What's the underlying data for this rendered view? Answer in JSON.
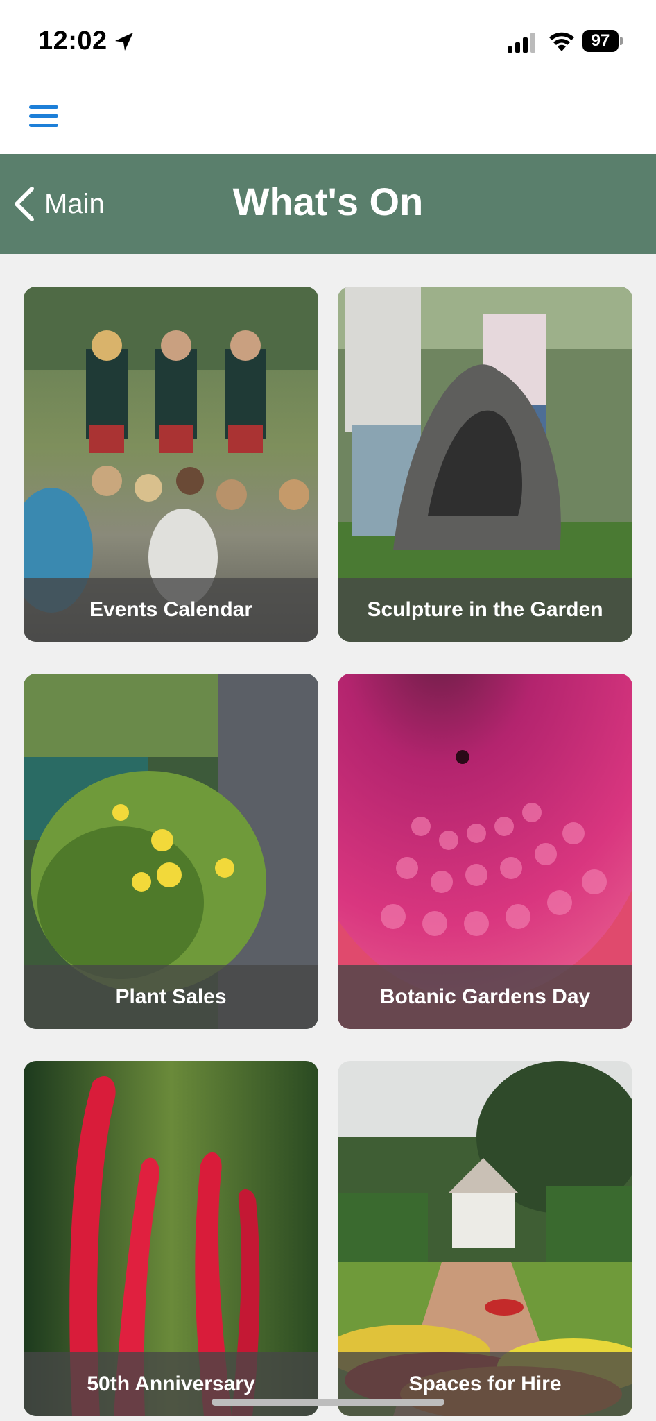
{
  "status_bar": {
    "time": "12:02",
    "battery": "97"
  },
  "header": {
    "back_label": "Main",
    "title": "What's On"
  },
  "tiles": [
    {
      "label": "Events Calendar"
    },
    {
      "label": "Sculpture in the Garden"
    },
    {
      "label": "Plant Sales"
    },
    {
      "label": "Botanic Gardens Day"
    },
    {
      "label": "50th Anniversary"
    },
    {
      "label": "Spaces for Hire"
    }
  ],
  "colors": {
    "header_bg": "#5a7f6c",
    "menu_accent": "#1d7fd8",
    "page_bg": "#f0f0f0",
    "label_overlay": "#464646"
  },
  "icons": [
    "location-arrow-icon",
    "signal-icon",
    "wifi-icon",
    "battery-icon",
    "hamburger-menu-icon",
    "chevron-left-icon"
  ]
}
